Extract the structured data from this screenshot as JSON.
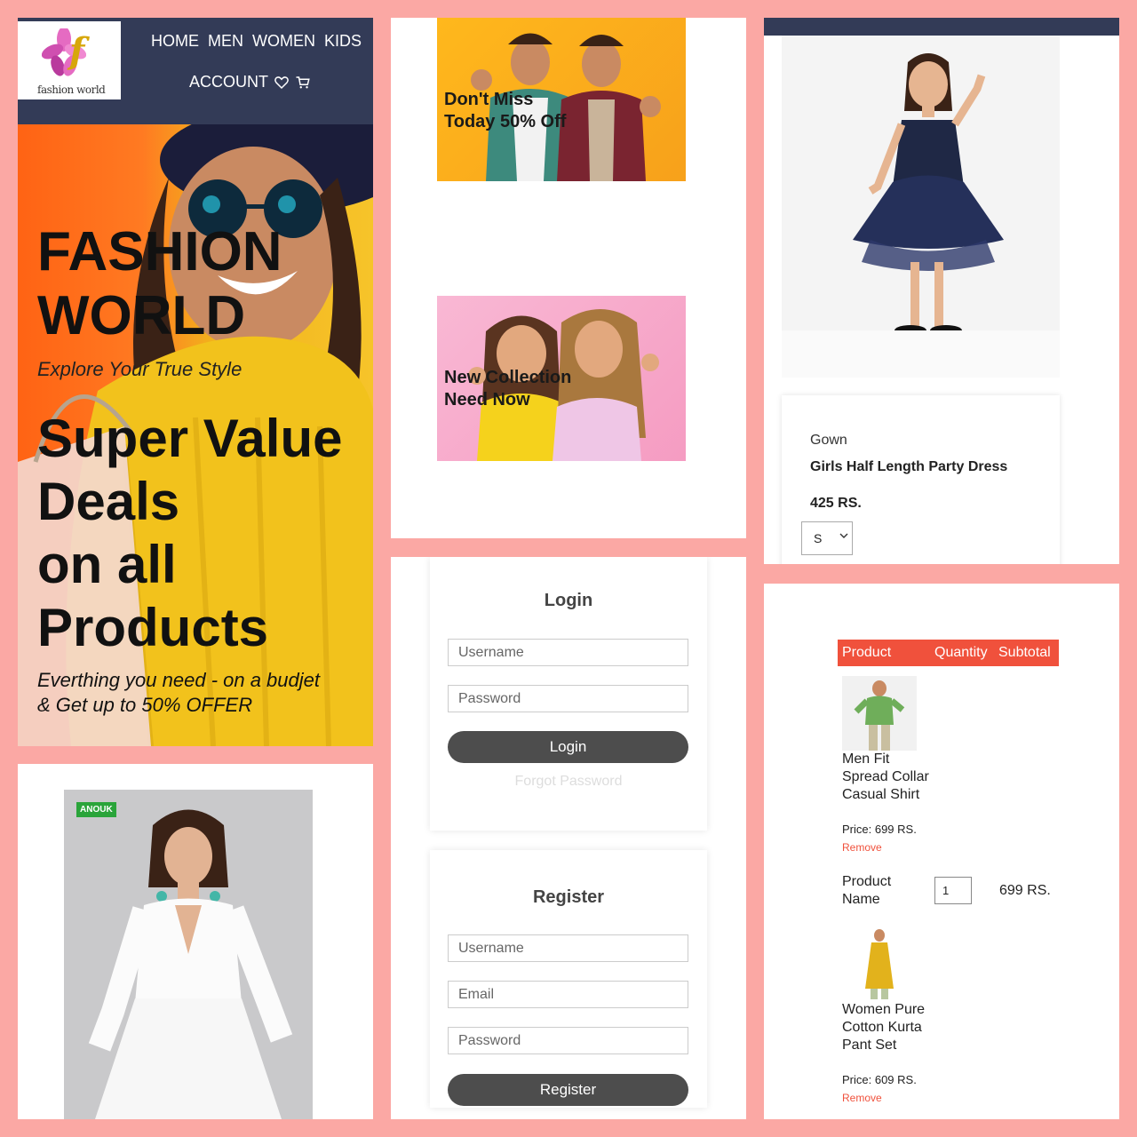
{
  "brand": {
    "logo_letter": "f",
    "logo_text": "fashion world"
  },
  "nav": {
    "links": [
      "HOME",
      "MEN",
      "WOMEN",
      "KIDS"
    ],
    "account": "ACCOUNT",
    "wishlist_icon": "heart-icon",
    "cart_icon": "cart-icon"
  },
  "hero": {
    "title_line1": "FASHION",
    "title_line2": "WORLD",
    "tagline": "Explore Your True Style",
    "headline": [
      "Super Value",
      "Deals",
      "on all",
      "Products"
    ],
    "footer_line1": "Everthing you need - on a budjet",
    "footer_line2": "& Get up to 50% OFFER"
  },
  "promos": [
    {
      "line1": "Don't Miss",
      "line2": "Today 50% Off"
    },
    {
      "line1": "New Collection",
      "line2": "Need Now"
    }
  ],
  "product": {
    "category": "Gown",
    "name": "Girls Half Length Party Dress",
    "price": "425 RS.",
    "size_selected": "S"
  },
  "login": {
    "title": "Login",
    "username_placeholder": "Username",
    "password_placeholder": "Password",
    "button": "Login",
    "forgot": "Forgot Password"
  },
  "register": {
    "title": "Register",
    "username_placeholder": "Username",
    "email_placeholder": "Email",
    "password_placeholder": "Password",
    "button": "Register"
  },
  "dress_badge": "ANOUK",
  "cart": {
    "headers": {
      "product": "Product",
      "quantity": "Quantity",
      "subtotal": "Subtotal"
    },
    "items": [
      {
        "name": "Men Fit Spread Collar Casual Shirt",
        "price": "Price: 699 RS.",
        "remove": "Remove"
      },
      {
        "name": "Women Pure Cotton Kurta Pant Set",
        "price": "Price: 609 RS.",
        "remove": "Remove"
      }
    ],
    "row_label": "Product Name",
    "quantity": "1",
    "subtotal": "699 RS."
  },
  "colors": {
    "background": "#fba8a4",
    "nav": "#333b57",
    "accent": "#f0513c",
    "button": "#4d4d4d"
  }
}
